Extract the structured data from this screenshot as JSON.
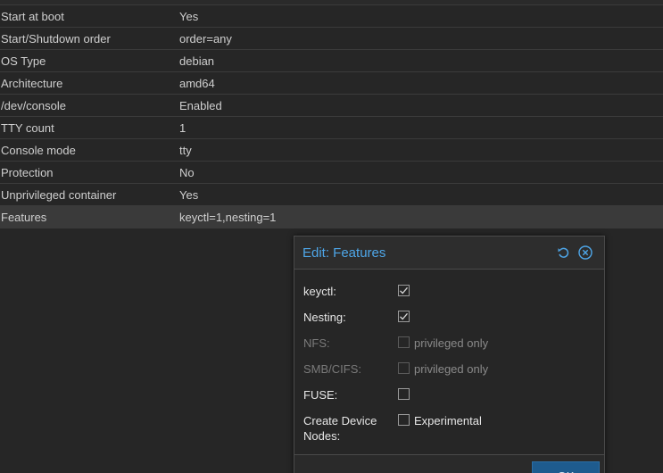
{
  "options": [
    {
      "key": "Start at boot",
      "value": "Yes"
    },
    {
      "key": "Start/Shutdown order",
      "value": "order=any"
    },
    {
      "key": "OS Type",
      "value": "debian"
    },
    {
      "key": "Architecture",
      "value": "amd64"
    },
    {
      "key": "/dev/console",
      "value": "Enabled"
    },
    {
      "key": "TTY count",
      "value": "1"
    },
    {
      "key": "Console mode",
      "value": "tty"
    },
    {
      "key": "Protection",
      "value": "No"
    },
    {
      "key": "Unprivileged container",
      "value": "Yes"
    },
    {
      "key": "Features",
      "value": "keyctl=1,nesting=1"
    }
  ],
  "dialog": {
    "title": "Edit: Features",
    "icons": {
      "reset": "reset-icon",
      "close": "close-icon"
    },
    "fields": [
      {
        "label": "keyctl:",
        "checked": true,
        "disabled": false,
        "box_label": ""
      },
      {
        "label": "Nesting:",
        "checked": true,
        "disabled": false,
        "box_label": ""
      },
      {
        "label": "NFS:",
        "checked": false,
        "disabled": true,
        "box_label": "privileged only"
      },
      {
        "label": "SMB/CIFS:",
        "checked": false,
        "disabled": true,
        "box_label": "privileged only"
      },
      {
        "label": "FUSE:",
        "checked": false,
        "disabled": false,
        "box_label": ""
      },
      {
        "label": "Create Device Nodes:",
        "checked": false,
        "disabled": false,
        "box_label": "Experimental"
      }
    ],
    "ok_label": "OK"
  },
  "colors": {
    "accent": "#4ea6e8",
    "button": "#1e5b8e",
    "background": "#262626"
  }
}
